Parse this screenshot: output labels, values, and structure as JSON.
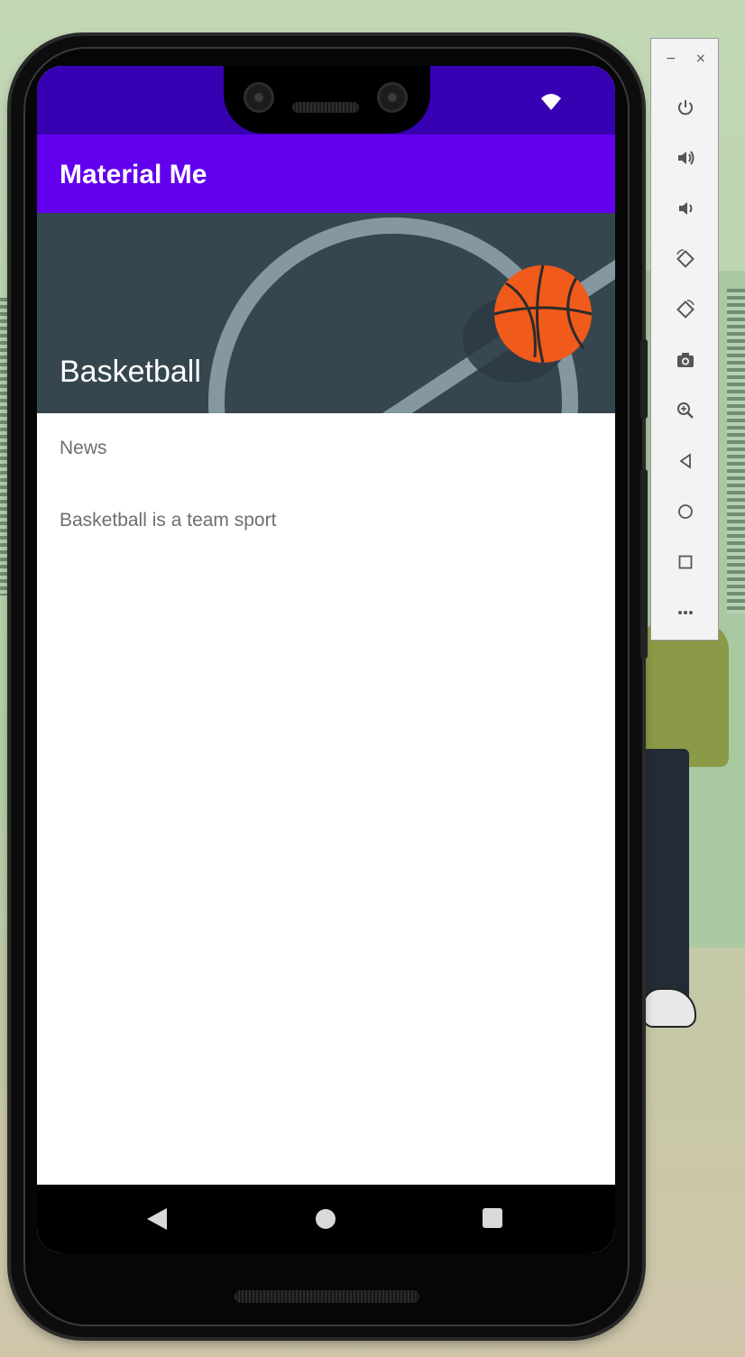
{
  "app": {
    "title": "Material Me"
  },
  "card": {
    "title": "Basketball",
    "subtitle": "News",
    "info": "Basketball is a team sport"
  },
  "colors": {
    "status_bar": "#3700b3",
    "app_bar": "#6200ee",
    "card_image_bg": "#36464f",
    "ball": "#f05a1a"
  },
  "status_bar": {
    "icons": [
      "wifi-icon"
    ]
  },
  "navigation_bar": {
    "buttons": [
      "back-icon",
      "home-icon",
      "recents-icon"
    ]
  },
  "emulator_toolbar": {
    "window_controls": {
      "minimize": "−",
      "close": "×"
    },
    "buttons": [
      "power-icon",
      "volume-up-icon",
      "volume-down-icon",
      "rotate-left-icon",
      "rotate-right-icon",
      "camera-icon",
      "zoom-icon",
      "back-icon",
      "home-icon",
      "overview-icon",
      "more-icon"
    ]
  }
}
